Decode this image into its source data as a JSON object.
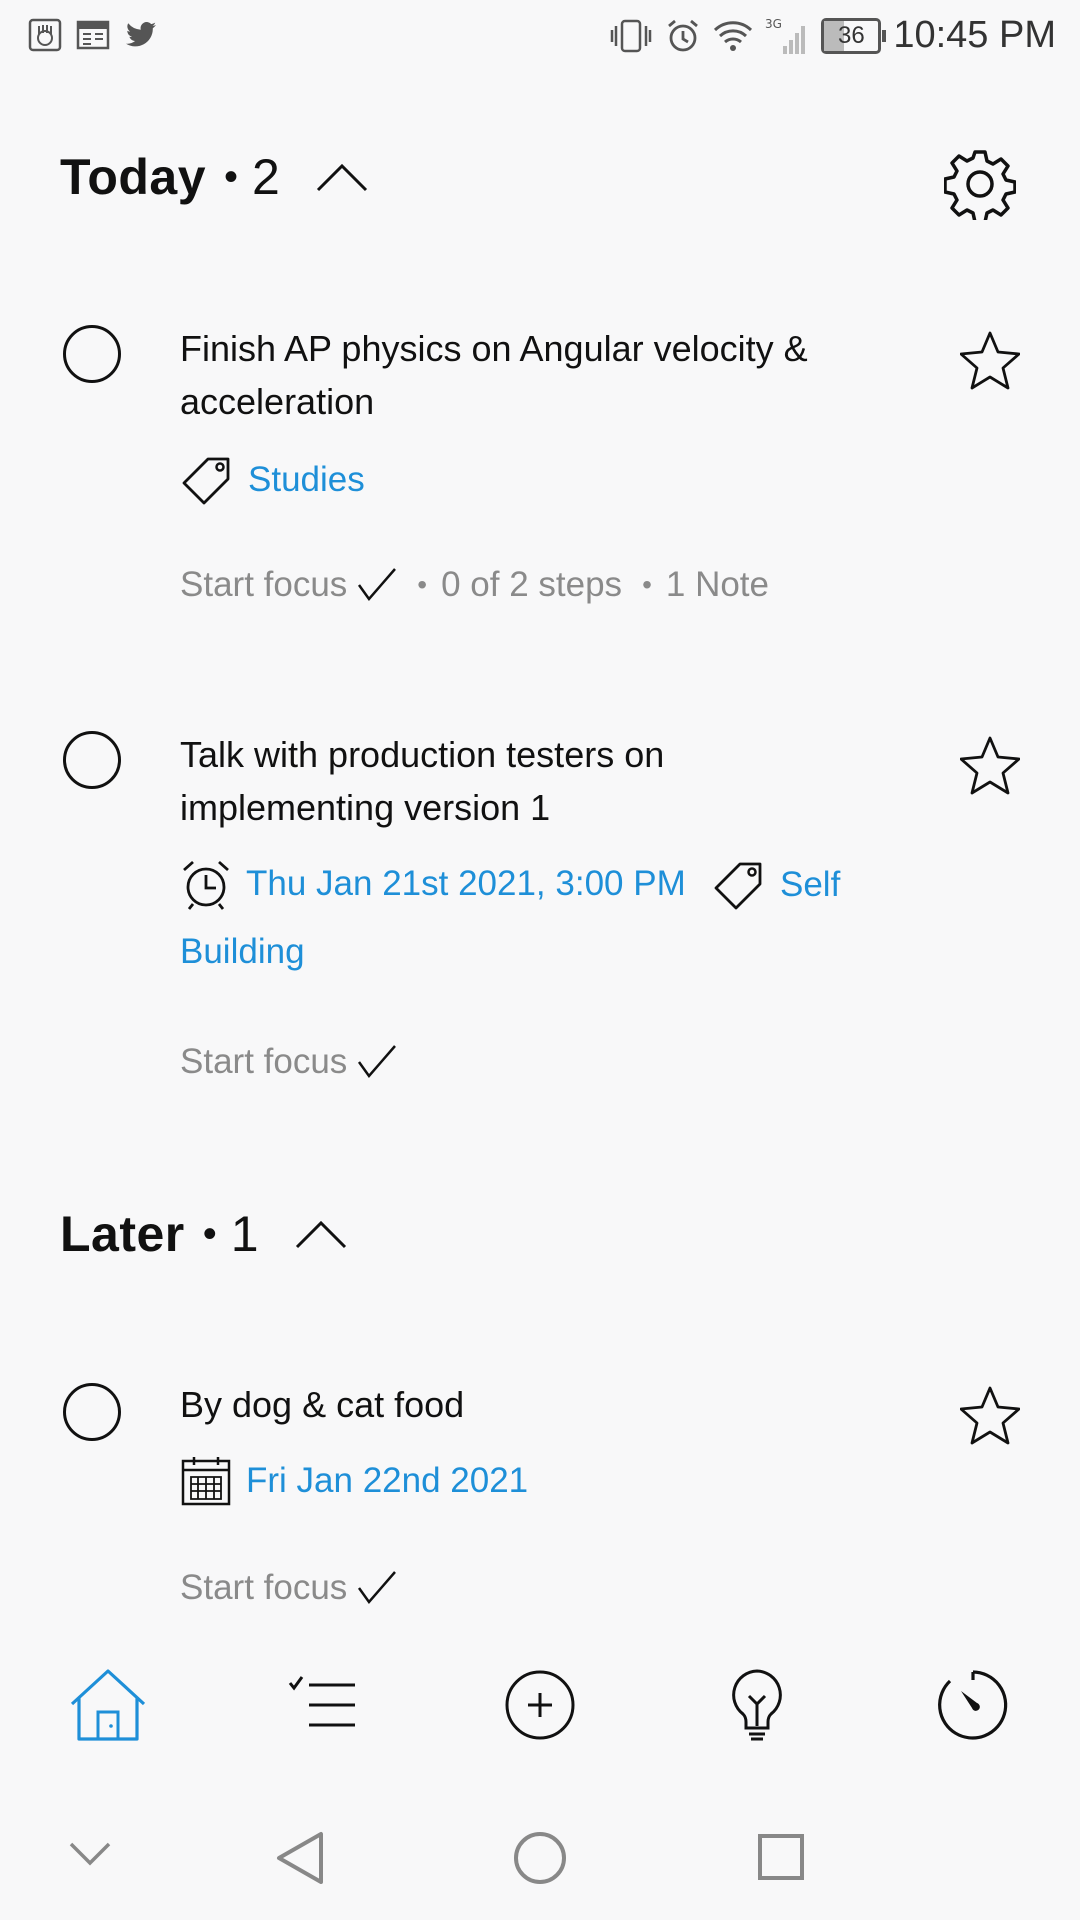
{
  "status_bar": {
    "time": "10:45 PM",
    "battery_level": "36",
    "network": "3G",
    "left_icons": [
      "app-notification-icon",
      "calendar-notification-icon",
      "twitter-icon"
    ],
    "right_icons": [
      "vibrate-icon",
      "alarm-icon",
      "wifi-icon",
      "signal-icon",
      "battery-icon"
    ]
  },
  "sections": [
    {
      "title": "Today",
      "dot": "•",
      "count": "2"
    },
    {
      "title": "Later",
      "dot": "•",
      "count": "1"
    }
  ],
  "tasks": [
    {
      "title": "Finish AP physics on Angular velocity & acceleration",
      "tag": "Studies",
      "focus_label": "Start focus",
      "steps": "0 of 2 steps",
      "notes": "1 Note"
    },
    {
      "title": "Talk with production testers on implementing version 1",
      "reminder": "Thu Jan 21st 2021, 3:00 PM",
      "tag_part1": "Self",
      "tag_part2": "Building",
      "focus_label": "Start focus"
    },
    {
      "title": "By dog & cat food",
      "due": "Fri Jan 22nd 2021",
      "focus_label": "Start focus"
    }
  ],
  "separator": "•",
  "colors": {
    "accent": "#1e8fd8",
    "muted_text": "#8a8a8a",
    "background": "#f8f8f9"
  },
  "bottom_nav": {
    "items": [
      "home-icon",
      "tasks-list-icon",
      "add-task-icon",
      "ideas-bulb-icon",
      "focus-timer-icon"
    ],
    "active": "home-icon"
  },
  "system_nav": [
    "hide-nav-icon",
    "back-icon",
    "home-circle-icon",
    "recents-icon"
  ]
}
